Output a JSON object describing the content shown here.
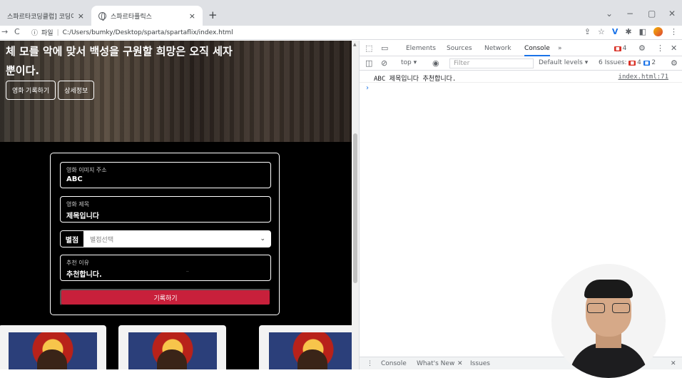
{
  "browser": {
    "tabs": [
      {
        "title": "스파르타코딩클럽] 코딩이 처음",
        "close": "×"
      },
      {
        "title": "스파르타플릭스",
        "close": "×"
      }
    ],
    "new_tab": "+",
    "window_controls": [
      "⌄",
      "−",
      "▢",
      "✕"
    ],
    "nav": {
      "back": "→",
      "reload": "C"
    },
    "address": {
      "info": "ⓘ",
      "scheme_label": "파일",
      "separator": "|",
      "url": "C:/Users/bumky/Desktop/sparta/spartaflix/index.html"
    }
  },
  "page": {
    "hero": {
      "text": "체 모를 악에 맞서 백성을 구원할 희망은 오직 세자뿐이다.",
      "buttons": [
        "영화 기록하기",
        "상세정보"
      ]
    },
    "form": {
      "image_field": {
        "label": "영화 이미지 주소",
        "value": "ABC"
      },
      "title_field": {
        "label": "영화 제목",
        "value": "제목입니다"
      },
      "rating": {
        "label": "별점",
        "placeholder": "별점선택",
        "chevron": "⌄"
      },
      "reason_field": {
        "label": "추천 이유",
        "value": "추천합니다.",
        "resize": ".."
      },
      "submit_label": "기록하기"
    },
    "cards_count_visible": 3
  },
  "devtools": {
    "tabs": [
      "Elements",
      "Sources",
      "Network",
      "Console",
      "»"
    ],
    "active_tab": "Console",
    "error_count": "4",
    "close": "✕",
    "more": "⋮",
    "settings": "⚙",
    "context": "top ▾",
    "filter_placeholder": "Filter",
    "levels": "Default levels ▾",
    "issues": {
      "label": "6 Issues:",
      "red": "4",
      "blue": "2"
    },
    "console_log": {
      "message": "ABC 제목입니다 추천합니다.",
      "source": "index.html:71"
    },
    "prompt": "›",
    "drawer": {
      "more": "⋮",
      "tabs": [
        "Console",
        "What's New",
        "Issues"
      ],
      "close_tab": "✕",
      "close": "✕"
    }
  }
}
